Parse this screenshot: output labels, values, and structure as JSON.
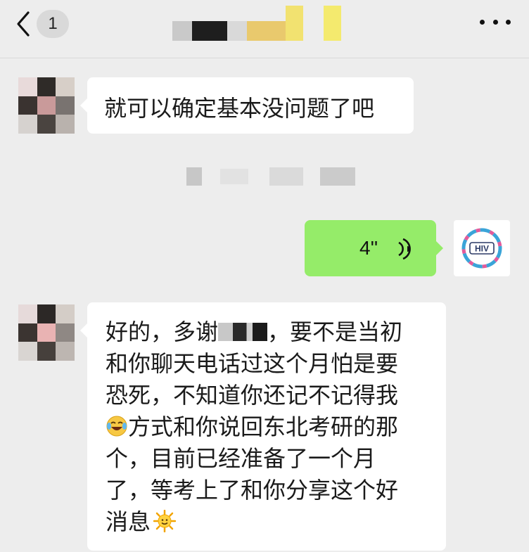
{
  "header": {
    "unread_count": "1",
    "title_obscured": true
  },
  "messages": [
    {
      "direction": "incoming",
      "type": "text",
      "text": "就可以确定基本没问题了吧"
    },
    {
      "direction": "outgoing",
      "type": "voice",
      "duration": "4''"
    },
    {
      "direction": "incoming",
      "type": "text",
      "lines": [
        [
          "好的，多谢",
          "[redacted]",
          "，要不是当初"
        ],
        "和你聊天电话过这个月怕是要",
        "恐死，不知道你还记不记得我",
        [
          "[laughing-crying-emoji]",
          "方式和你说回东北考研的那"
        ],
        "个，目前已经准备了一个月",
        "了，等考上了和你分享这个好",
        [
          "消息",
          "[sun-emoji]"
        ]
      ],
      "line1_a": "好的，多谢",
      "line1_b": "，要不是当初",
      "line2": "和你聊天电话过这个月怕是要",
      "line3": "恐死，不知道你还记不记得我",
      "line4": "方式和你说回东北考研的那",
      "line5": "个，目前已经准备了一个月",
      "line6": "了，等考上了和你分享这个好",
      "line7": "消息"
    }
  ],
  "outgoing_avatar": {
    "label": "HIV"
  },
  "colors": {
    "background": "#ededed",
    "incoming_bubble": "#ffffff",
    "outgoing_bubble": "#95ec69"
  },
  "icons": {
    "back": "chevron-left-icon",
    "more": "more-dots-icon",
    "voice": "voice-waves-icon",
    "emoji_laugh": "laughing-crying-emoji",
    "emoji_sun": "sun-emoji"
  }
}
